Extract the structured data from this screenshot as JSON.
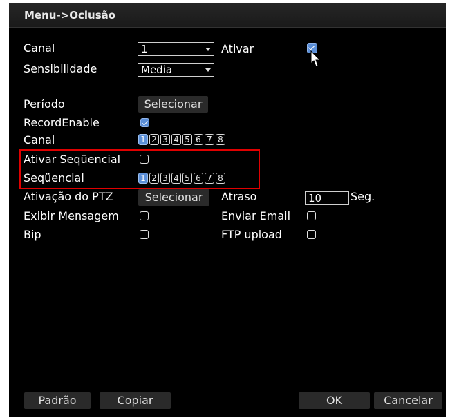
{
  "window": {
    "title": "Menu->Oclusão"
  },
  "top": {
    "channel_label": "Canal",
    "channel_value": "1",
    "enable_label": "Ativar",
    "enable_checked": true,
    "sensitivity_label": "Sensibilidade",
    "sensitivity_value": "Media"
  },
  "settings": {
    "period_label": "Período",
    "period_button": "Selecionar",
    "record_enable_label": "RecordEnable",
    "record_enable_checked": true,
    "record_channel_label": "Canal",
    "channels": [
      "1",
      "2",
      "3",
      "4",
      "5",
      "6",
      "7",
      "8"
    ],
    "record_channel_selected": "1",
    "tour_enable_label": "Ativar Seqüencial",
    "tour_enable_checked": false,
    "tour_label": "Seqüencial",
    "tour_channel_selected": "1",
    "ptz_label": "Ativação do PTZ",
    "ptz_button": "Selecionar",
    "delay_label": "Atraso",
    "delay_value": "10",
    "delay_unit": "Seg.",
    "show_message_label": "Exibir Mensagem",
    "show_message_checked": false,
    "send_email_label": "Enviar Email",
    "send_email_checked": false,
    "buzzer_label": "Bip",
    "buzzer_checked": false,
    "ftp_label": "FTP upload",
    "ftp_checked": false
  },
  "footer": {
    "default_button": "Padrão",
    "copy_button": "Copiar",
    "ok_button": "OK",
    "cancel_button": "Cancelar"
  },
  "colors": {
    "accent": "#5b8fd8",
    "highlight_box": "#e00000",
    "background": "#000000"
  }
}
